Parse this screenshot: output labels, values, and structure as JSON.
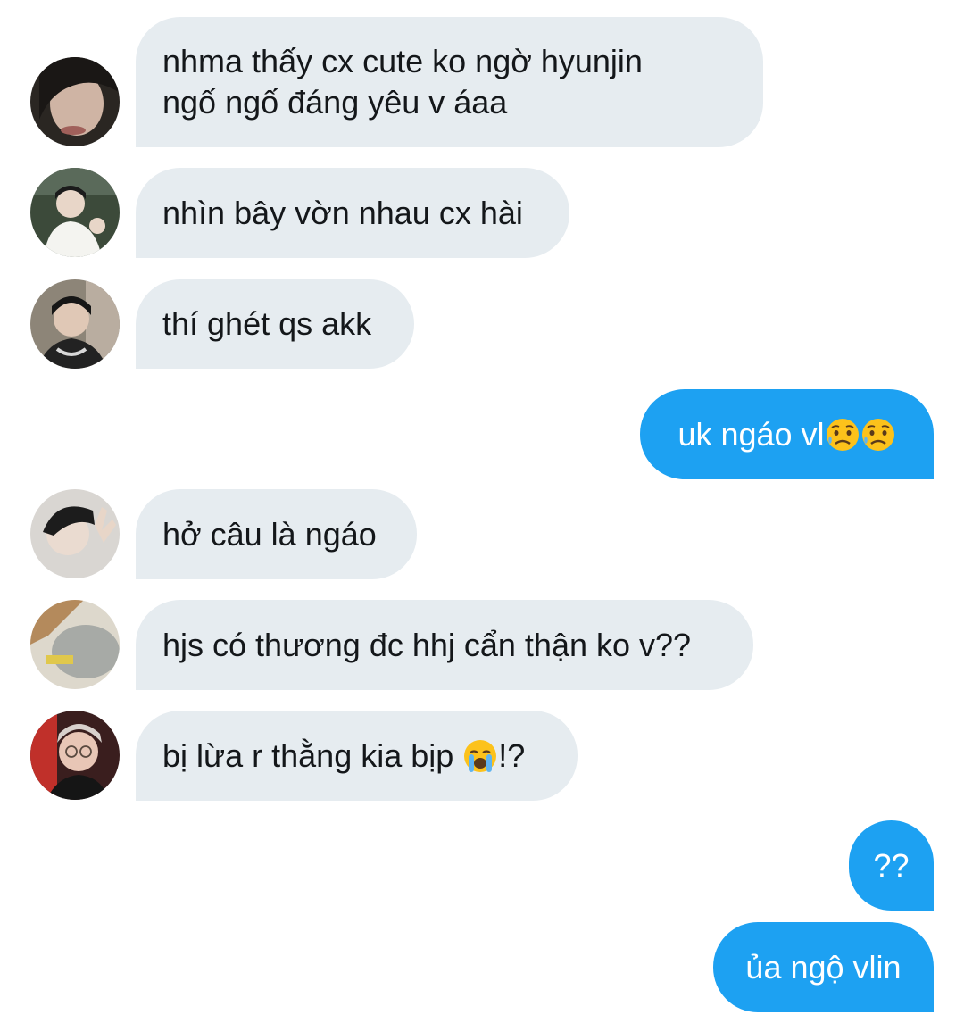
{
  "messages": [
    {
      "side": "in",
      "text_line1": "nhma thấy cx cute ko ngờ hyunjin",
      "text_line2": "ngố ngố đáng yêu v áaa",
      "avatar_icon": "user-avatar-1"
    },
    {
      "side": "in",
      "text": "nhìn bây vờn nhau cx hài",
      "avatar_icon": "user-avatar-2"
    },
    {
      "side": "in",
      "text": "thí ghét qs akk",
      "avatar_icon": "user-avatar-3"
    },
    {
      "side": "out",
      "text": "uk ngáo vl",
      "emojis": [
        "sad-sweat-emoji",
        "sad-sweat-emoji"
      ]
    },
    {
      "side": "in",
      "text": "hở câu là ngáo",
      "avatar_icon": "user-avatar-4"
    },
    {
      "side": "in",
      "text": "hjs có thương đc hhj cẩn thận ko v??",
      "avatar_icon": "user-avatar-5"
    },
    {
      "side": "in",
      "text_before": "bị lừa r thằng kia bịp ",
      "emoji": "loudly-crying-emoji",
      "text_after": "!?",
      "avatar_icon": "user-avatar-6"
    },
    {
      "side": "out",
      "text": "??"
    },
    {
      "side": "out",
      "text": "ủa ngộ vlin"
    }
  ],
  "colors": {
    "incoming_bubble": "#e6ecf0",
    "outgoing_bubble": "#1da1f2",
    "incoming_text": "#14171a",
    "outgoing_text": "#ffffff"
  }
}
